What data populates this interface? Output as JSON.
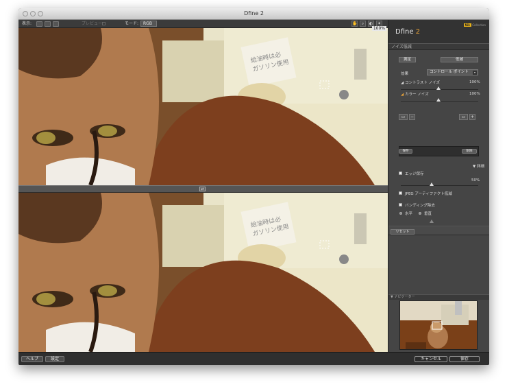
{
  "window": {
    "title": "Dfine 2"
  },
  "toolbar": {
    "view_label": "表示:",
    "preview_label": "プレビュー",
    "mode_label": "モード:",
    "mode_value": "RGB",
    "zoom": "100%"
  },
  "panel": {
    "brand": "Dfine",
    "brand_version": "2",
    "brand_badge_nik": "Nik",
    "brand_badge_text": "Collection",
    "section_noise": "ノイズ低減",
    "tab_measure": "測定",
    "tab_reduce": "低減",
    "method_label": "効果",
    "method_value": "コントロール ポイント",
    "contrast_noise_label": "コントラスト ノイズ",
    "contrast_noise_value": "100%",
    "color_noise_label": "カラー ノイズ",
    "color_noise_value": "100%",
    "btn_save": "保存",
    "btn_delete": "削除",
    "details_label": "詳細",
    "edge_preserve_label": "エッジ保存",
    "edge_preserve_value": "50%",
    "jpeg_label": "JPEG アーティファクト低減",
    "banding_label": "バンディング除去",
    "horizontal_label": "水平",
    "vertical_label": "垂直",
    "reset_label": "リセット",
    "navigator_label": "ナビゲーター"
  },
  "bottom": {
    "help": "ヘルプ",
    "settings": "設定",
    "cancel": "キャンセル",
    "save": "保存"
  },
  "colors": {
    "accent": "#e8a33a",
    "panel_bg": "#454545",
    "toolbar_bg": "#3b3b3b"
  }
}
